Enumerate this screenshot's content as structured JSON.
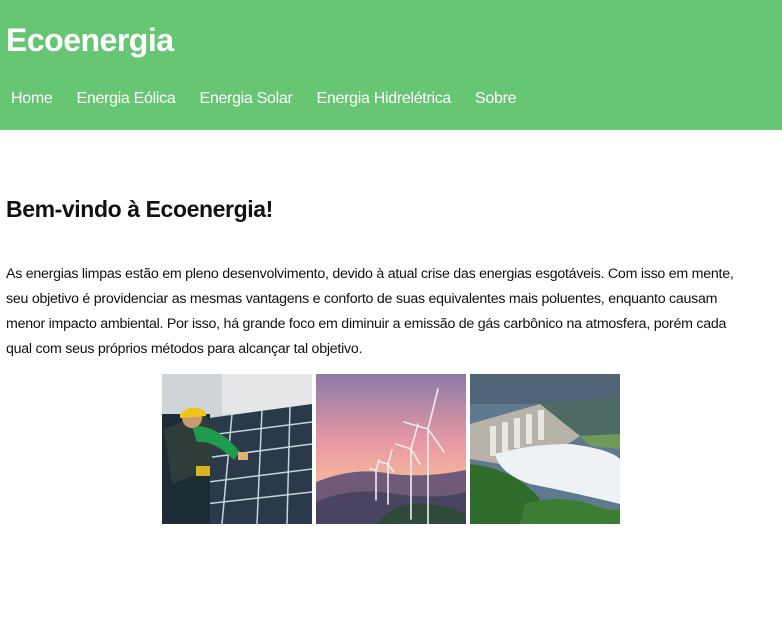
{
  "site": {
    "title": "Ecoenergia",
    "brand_color": "#66c673"
  },
  "nav": {
    "items": [
      {
        "label": "Home"
      },
      {
        "label": "Energia Eólica"
      },
      {
        "label": "Energia Solar"
      },
      {
        "label": "Energia Hidrelétrica"
      },
      {
        "label": "Sobre"
      }
    ]
  },
  "main": {
    "heading": "Bem-vindo à Ecoenergia!",
    "intro": "As energias limpas estão em pleno desenvolvimento, devido à atual crise das energias esgotáveis. Com isso em mente, seu objetivo é providenciar as mesmas vantagens e conforto de suas equivalentes mais poluentes, enquanto causam menor impacto ambiental. Por isso, há grande foco em diminuir a emissão de gás carbônico na atmosfera, porém cada qual com seus próprios métodos para alcançar tal objetivo."
  },
  "gallery": {
    "images": [
      {
        "icon": "solar-panel-worker-photo"
      },
      {
        "icon": "wind-turbines-sunset-photo"
      },
      {
        "icon": "hydroelectric-dam-photo"
      }
    ]
  }
}
